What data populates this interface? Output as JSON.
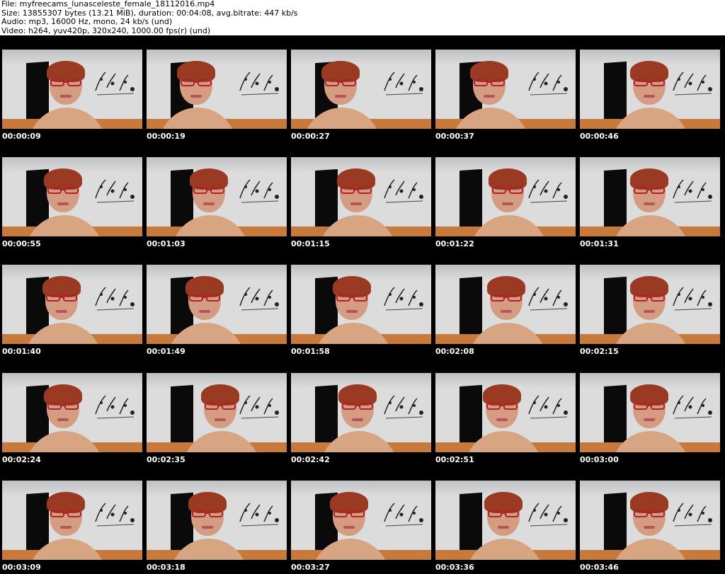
{
  "file_info": {
    "file": "File: myfreecams_lunasceleste_female_18112016.mp4",
    "size": "Size: 13855307 bytes (13.21 MiB), duration: 00:04:08, avg.bitrate: 447 kb/s",
    "audio": "Audio: mp3, 16000 Hz, mono, 24 kb/s (und)",
    "video": "Video: h264, yuv420p, 320x240, 1000.00 fps(r) (und)"
  },
  "colors": {
    "sheet_background": "#000000",
    "timestamp_text": "#ffffff",
    "wall": "#dcdcdc",
    "door": "#0a0a0a",
    "hair": "#9b3a22",
    "glasses": "#b0202a",
    "floor": "#c77a3c"
  },
  "thumbnails": [
    {
      "time": "00:00:09"
    },
    {
      "time": "00:00:19"
    },
    {
      "time": "00:00:27"
    },
    {
      "time": "00:00:37"
    },
    {
      "time": "00:00:46"
    },
    {
      "time": "00:00:55"
    },
    {
      "time": "00:01:03"
    },
    {
      "time": "00:01:15"
    },
    {
      "time": "00:01:22"
    },
    {
      "time": "00:01:31"
    },
    {
      "time": "00:01:40"
    },
    {
      "time": "00:01:49"
    },
    {
      "time": "00:01:58"
    },
    {
      "time": "00:02:08"
    },
    {
      "time": "00:02:15"
    },
    {
      "time": "00:02:24"
    },
    {
      "time": "00:02:35"
    },
    {
      "time": "00:02:42"
    },
    {
      "time": "00:02:51"
    },
    {
      "time": "00:03:00"
    },
    {
      "time": "00:03:09"
    },
    {
      "time": "00:03:18"
    },
    {
      "time": "00:03:27"
    },
    {
      "time": "00:03:36"
    },
    {
      "time": "00:03:46"
    }
  ]
}
